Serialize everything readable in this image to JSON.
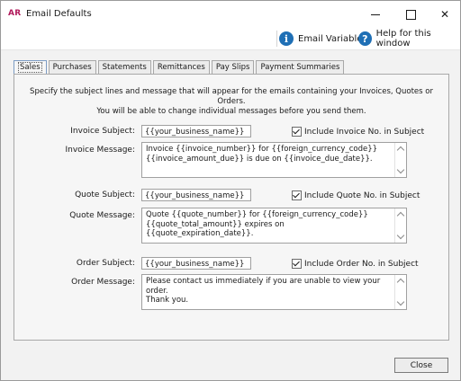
{
  "window": {
    "logo": "AR",
    "title": "Email Defaults"
  },
  "help_bar": {
    "email_variables": "Email Variables",
    "help": "Help for this window"
  },
  "tabs": [
    {
      "label": "Sales"
    },
    {
      "label": "Purchases"
    },
    {
      "label": "Statements"
    },
    {
      "label": "Remittances"
    },
    {
      "label": "Pay Slips"
    },
    {
      "label": "Payment Summaries"
    }
  ],
  "instructions": {
    "line1": "Specify the subject lines and message that will appear for the emails containing your Invoices, Quotes or Orders.",
    "line2": "You will be able to change individual messages before you send them."
  },
  "invoice": {
    "subject_label": "Invoice Subject:",
    "subject_value": "{{your_business_name}}",
    "include_label": "Include Invoice No. in Subject",
    "include_checked": true,
    "message_label": "Invoice Message:",
    "message_value": "Invoice {{invoice_number}} for {{foreign_currency_code}}\n{{invoice_amount_due}} is due on {{invoice_due_date}}."
  },
  "quote": {
    "subject_label": "Quote Subject:",
    "subject_value": "{{your_business_name}}",
    "include_label": "Include Quote No. in Subject",
    "include_checked": true,
    "message_label": "Quote Message:",
    "message_value": "Quote {{quote_number}} for {{foreign_currency_code}}\n{{quote_total_amount}} expires on {{quote_expiration_date}}."
  },
  "order": {
    "subject_label": "Order Subject:",
    "subject_value": "{{your_business_name}}",
    "include_label": "Include Order No. in Subject",
    "include_checked": true,
    "message_label": "Order Message:",
    "message_value": "Please contact us immediately if you are unable to view your order.\nThank you."
  },
  "footer": {
    "close_label": "Close"
  },
  "colors": {
    "accent": "#1f6fb5",
    "logo": "#b0185a"
  }
}
